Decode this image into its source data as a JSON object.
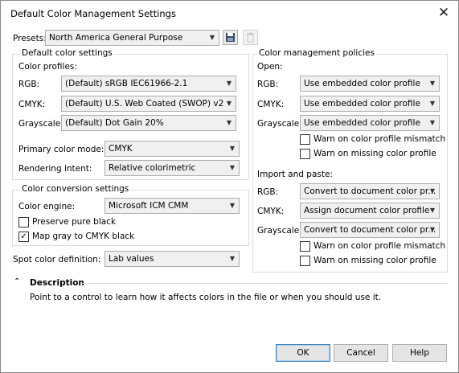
{
  "window": {
    "title": "Default Color Management Settings"
  },
  "icons": {
    "close": "close-icon",
    "save": "save-preset-icon",
    "delete": "delete-preset-icon",
    "collapse": "chevron-up-icon"
  },
  "presets": {
    "label": "Presets:",
    "value": "North America General Purpose"
  },
  "default_settings": {
    "heading": "Default color settings",
    "profiles_label": "Color profiles:",
    "rgb_label": "RGB:",
    "rgb_value": "(Default) sRGB IEC61966-2.1",
    "cmyk_label": "CMYK:",
    "cmyk_value": "(Default) U.S. Web Coated (SWOP) v2",
    "gray_label": "Grayscale:",
    "gray_value": "(Default) Dot Gain 20%",
    "primary_mode_label": "Primary color mode:",
    "primary_mode_value": "CMYK",
    "intent_label": "Rendering intent:",
    "intent_value": "Relative colorimetric"
  },
  "conversion": {
    "heading": "Color conversion settings",
    "engine_label": "Color engine:",
    "engine_value": "Microsoft ICM CMM",
    "preserve_black_label": "Preserve pure black",
    "preserve_black_checked": false,
    "map_gray_label": "Map gray to CMYK black",
    "map_gray_checked": true
  },
  "spot": {
    "label": "Spot color definition:",
    "value": "Lab values"
  },
  "policies": {
    "heading": "Color management policies",
    "open": {
      "label": "Open:",
      "rgb_label": "RGB:",
      "rgb_value": "Use embedded color profile",
      "cmyk_label": "CMYK:",
      "cmyk_value": "Use embedded color profile",
      "gray_label": "Grayscale:",
      "gray_value": "Use embedded color profile",
      "warn_mismatch": "Warn on color profile mismatch",
      "warn_missing": "Warn on missing color profile"
    },
    "import": {
      "label": "Import and paste:",
      "rgb_label": "RGB:",
      "rgb_value": "Convert to document color pr...",
      "cmyk_label": "CMYK:",
      "cmyk_value": "Assign document color profile",
      "gray_label": "Grayscale:",
      "gray_value": "Convert to document color pr...",
      "warn_mismatch": "Warn on color profile mismatch",
      "warn_missing": "Warn on missing color profile"
    }
  },
  "description": {
    "heading": "Description",
    "text": "Point to a control to learn how it affects colors in the file or when you should use it."
  },
  "buttons": {
    "ok": "OK",
    "cancel": "Cancel",
    "help": "Help"
  }
}
